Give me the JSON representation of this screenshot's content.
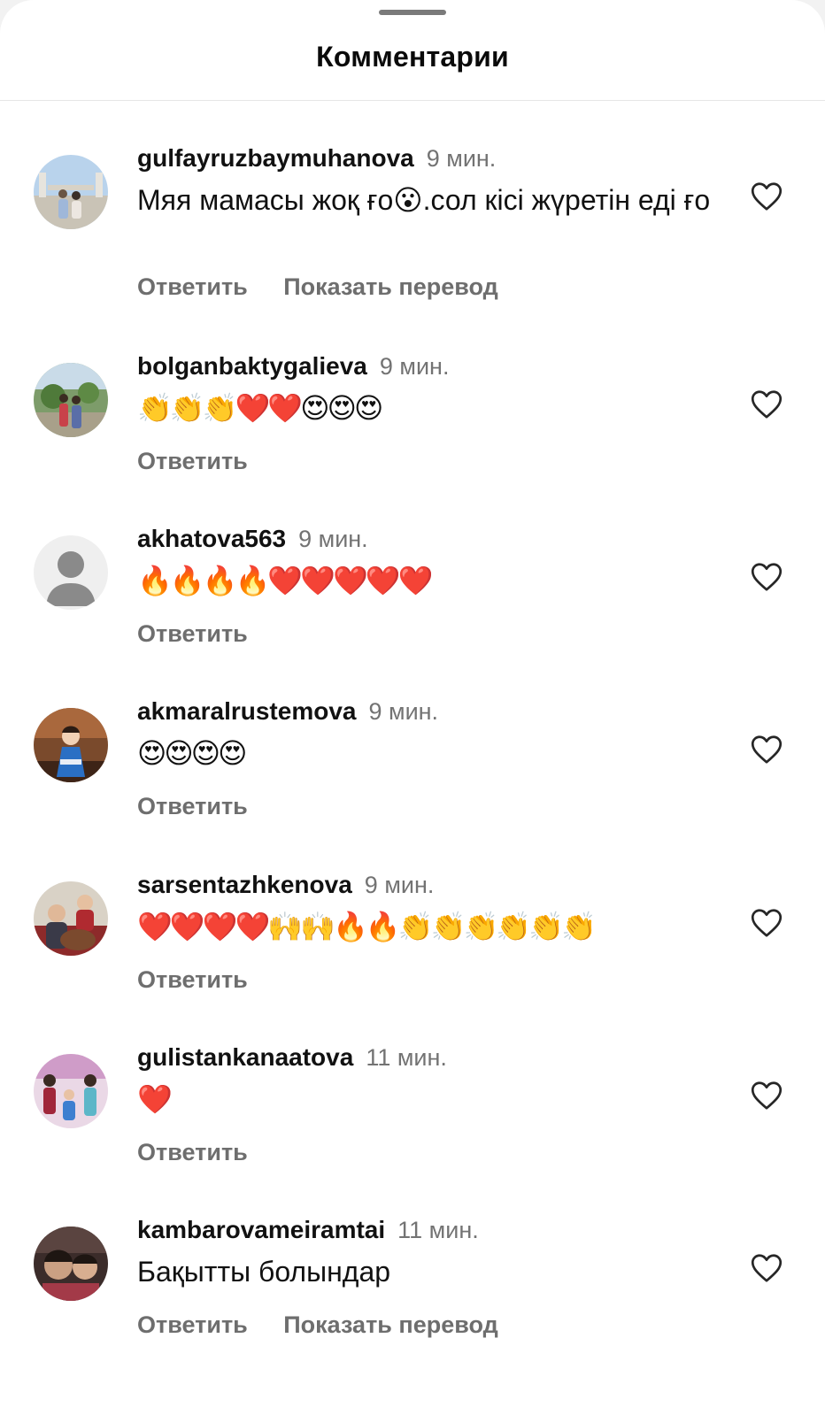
{
  "header": {
    "title": "Комментарии"
  },
  "comments": [
    {
      "username": "gulfayruzbaymuhanova",
      "time": "9 мин.",
      "text": "Мяя мамасы жоқ ғо😮.сол кісі жүретін еді ғо",
      "reply": "Ответить",
      "translate": "Показать перевод"
    },
    {
      "username": "bolganbaktygalieva",
      "time": "9 мин.",
      "text": "👏👏👏❤️❤️😍😍😍",
      "reply": "Ответить"
    },
    {
      "username": "akhatova563",
      "time": "9 мин.",
      "text": "🔥🔥🔥🔥❤️❤️❤️❤️❤️",
      "reply": "Ответить"
    },
    {
      "username": "akmaralrustemova",
      "time": "9 мин.",
      "text": "😍😍😍😍",
      "reply": "Ответить"
    },
    {
      "username": "sarsentazhkenova",
      "time": "9 мин.",
      "text": "❤️❤️❤️❤️🙌🙌🔥🔥👏👏👏👏👏👏",
      "reply": "Ответить"
    },
    {
      "username": "gulistankanaatova",
      "time": "11 мин.",
      "text": "❤️",
      "reply": "Ответить"
    },
    {
      "username": "kambarovameiramtai",
      "time": "11 мин.",
      "text": "Бақытты болындар",
      "reply": "Ответить",
      "translate": "Показать перевод"
    }
  ],
  "icons": {
    "like": "heart-outline-icon",
    "default_avatar": "user-silhouette-icon"
  },
  "colors": {
    "secondary_text": "#737373",
    "action_text": "#6e6e6e"
  }
}
